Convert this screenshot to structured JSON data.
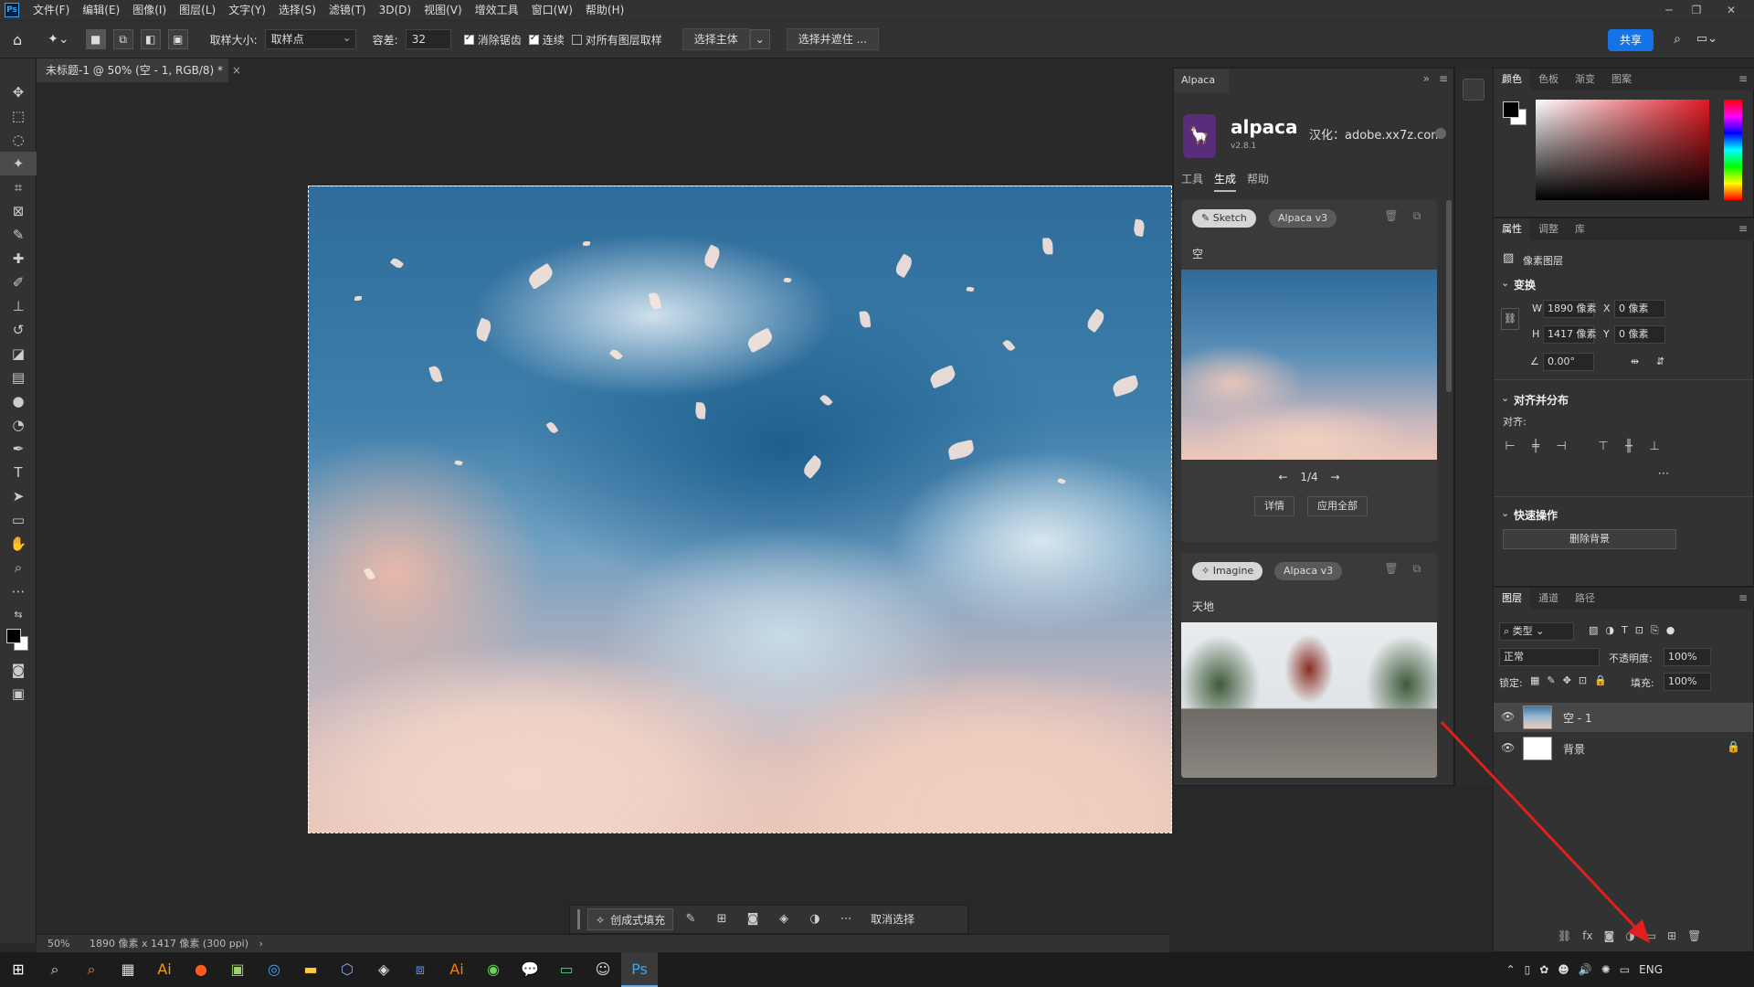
{
  "menubar": {
    "items": [
      "文件(F)",
      "编辑(E)",
      "图像(I)",
      "图层(L)",
      "文字(Y)",
      "选择(S)",
      "滤镜(T)",
      "3D(D)",
      "视图(V)",
      "增效工具",
      "窗口(W)",
      "帮助(H)"
    ]
  },
  "options": {
    "sample_size_label": "取样大小:",
    "sample_size_value": "取样点",
    "tolerance_label": "容差:",
    "tolerance_value": "32",
    "antialias_label": "消除锯齿",
    "contiguous_label": "连续",
    "all_layers_label": "对所有图层取样",
    "select_subject": "选择主体",
    "select_mask": "选择并遮住 ...",
    "share": "共享"
  },
  "document": {
    "tab_title": "未标题-1 @ 50% (空 - 1, RGB/8) *",
    "status_zoom": "50%",
    "status_info": "1890 像素 x 1417 像素 (300 ppi)"
  },
  "context_bar": {
    "gen_fill": "创成式填充",
    "deselect": "取消选择"
  },
  "alpaca": {
    "tab": "Alpaca",
    "title": "alpaca",
    "version": "v2.8.1",
    "locale": "汉化：adobe.xx7z.com",
    "nav": [
      "工具",
      "生成",
      "帮助"
    ],
    "cards": [
      {
        "mode": "Sketch",
        "model": "Alpaca v3",
        "prompt": "空",
        "pager": "1/4",
        "details": "详情",
        "apply_all": "应用全部"
      },
      {
        "mode": "Imagine",
        "model": "Alpaca v3",
        "prompt": "天地"
      }
    ]
  },
  "color_panel": {
    "tabs": [
      "颜色",
      "色板",
      "渐变",
      "图案"
    ]
  },
  "properties": {
    "tabs": [
      "属性",
      "调整",
      "库"
    ],
    "layer_type": "像素图层",
    "transform_title": "变换",
    "w_label": "W",
    "w_value": "1890 像素",
    "x_label": "X",
    "x_value": "0 像素",
    "h_label": "H",
    "h_value": "1417 像素",
    "y_label": "Y",
    "y_value": "0 像素",
    "angle_value": "0.00°",
    "align_title": "对齐并分布",
    "align_label": "对齐:",
    "quick_title": "快速操作",
    "remove_bg": "删除背景"
  },
  "layers": {
    "tabs": [
      "图层",
      "通道",
      "路径"
    ],
    "filter_label": "类型",
    "blend_mode": "正常",
    "opacity_label": "不透明度:",
    "opacity_value": "100%",
    "lock_label": "锁定:",
    "fill_label": "填充:",
    "fill_value": "100%",
    "items": [
      {
        "name": "空 - 1"
      },
      {
        "name": "背景"
      }
    ]
  },
  "taskbar": {
    "lang": "ENG"
  }
}
